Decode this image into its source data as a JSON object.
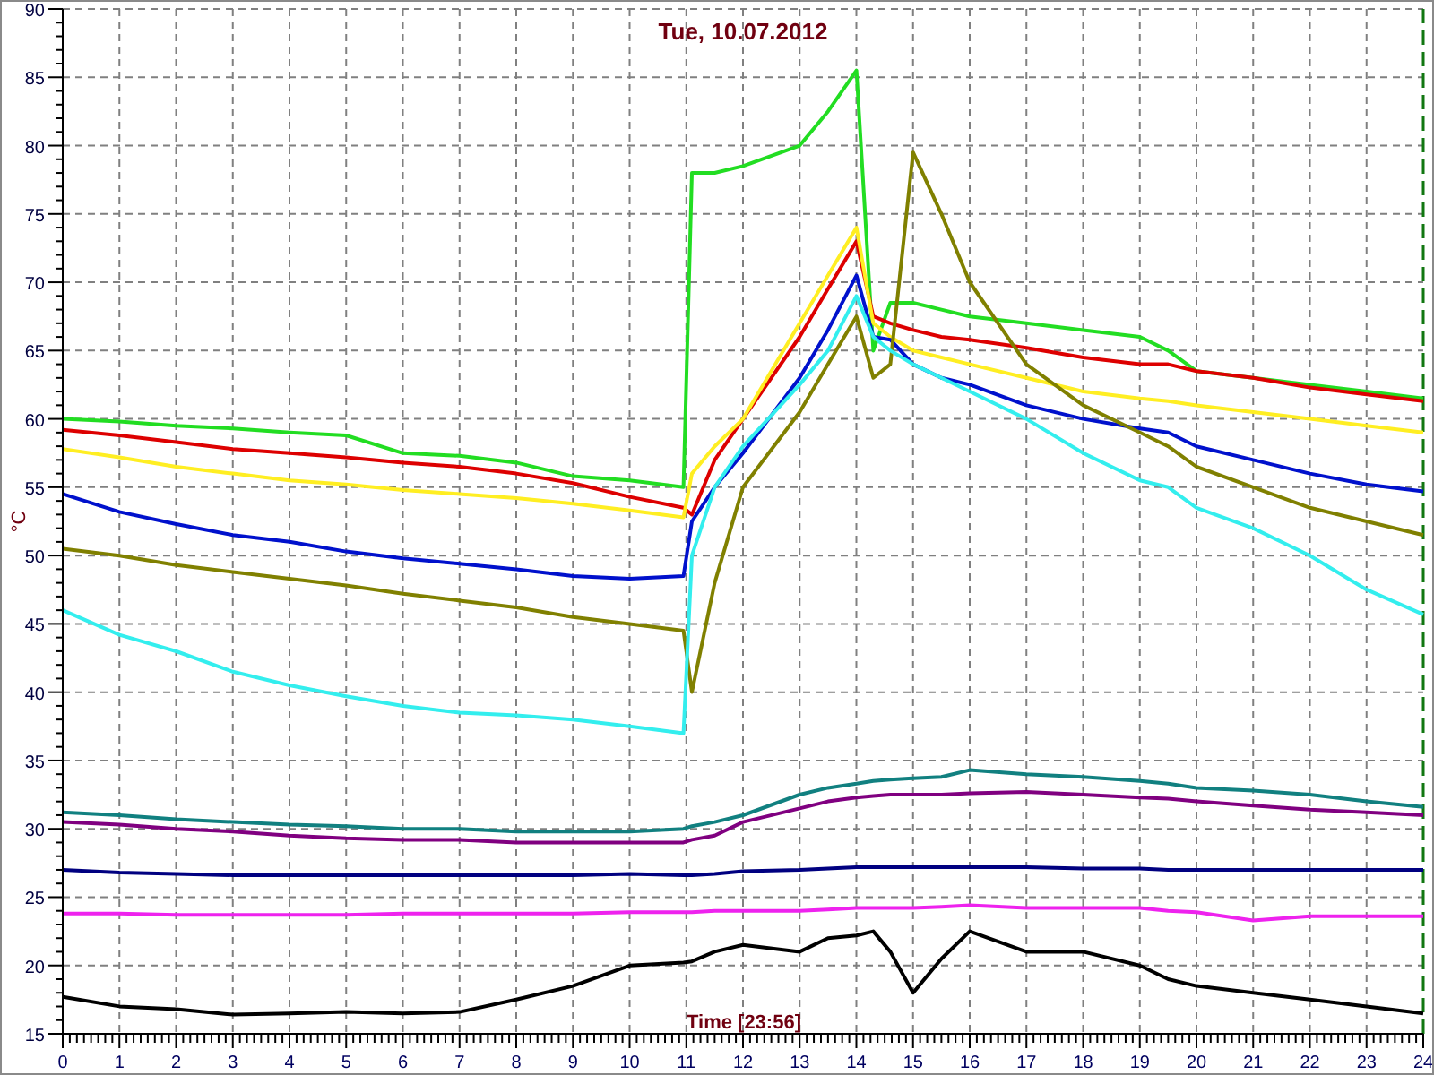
{
  "chart": {
    "chart_data": {
      "type": "line",
      "title": "Tue, 10.07.2012",
      "xlabel": "Time [23:56]",
      "ylabel": "°C",
      "grid": true,
      "xlim": [
        0,
        24
      ],
      "ylim": [
        15,
        90
      ],
      "xticks": [
        0,
        1,
        2,
        3,
        4,
        5,
        6,
        7,
        8,
        9,
        10,
        11,
        12,
        13,
        14,
        15,
        16,
        17,
        18,
        19,
        20,
        21,
        22,
        23,
        24
      ],
      "yticks": [
        15,
        20,
        25,
        30,
        35,
        40,
        45,
        50,
        55,
        60,
        65,
        70,
        75,
        80,
        85,
        90
      ],
      "x": [
        0,
        1,
        2,
        3,
        4,
        5,
        6,
        7,
        8,
        9,
        10,
        10.95,
        11.1,
        11.5,
        12,
        13,
        13.5,
        14,
        14.3,
        14.6,
        15,
        15.5,
        16,
        17,
        18,
        19,
        19.5,
        20,
        21,
        22,
        23,
        24
      ],
      "series": [
        {
          "color": "#22dd22",
          "values": [
            60,
            59.8,
            59.5,
            59.3,
            59,
            58.8,
            57.5,
            57.3,
            56.8,
            55.8,
            55.5,
            55,
            78,
            78,
            78.5,
            80,
            82.5,
            85.5,
            65,
            68.5,
            68.5,
            68,
            67.5,
            67,
            66.5,
            66,
            65,
            63.5,
            63,
            62.5,
            62,
            61.5
          ]
        },
        {
          "color": "#dd0000",
          "values": [
            59.2,
            58.8,
            58.3,
            57.8,
            57.5,
            57.2,
            56.8,
            56.5,
            56,
            55.3,
            54.3,
            53.5,
            53,
            57,
            60,
            66,
            69.5,
            73,
            67.5,
            67,
            66.5,
            66,
            65.8,
            65.2,
            64.5,
            64,
            64,
            63.5,
            63,
            62.3,
            61.8,
            61.3
          ]
        },
        {
          "color": "#ffee22",
          "values": [
            57.8,
            57.2,
            56.5,
            56,
            55.5,
            55.2,
            54.8,
            54.5,
            54.2,
            53.8,
            53.3,
            52.8,
            56,
            58,
            60,
            67,
            70.5,
            74,
            67,
            66,
            65,
            64.5,
            64,
            63,
            62,
            61.5,
            61.3,
            61,
            60.5,
            60,
            59.5,
            59
          ]
        },
        {
          "color": "#0011cc",
          "values": [
            54.5,
            53.2,
            52.3,
            51.5,
            51,
            50.3,
            49.8,
            49.4,
            49,
            48.5,
            48.3,
            48.5,
            52.5,
            55,
            57.5,
            63,
            66.5,
            70.5,
            66,
            65.8,
            64,
            63,
            62.5,
            61,
            60,
            59.3,
            59,
            58,
            57,
            56,
            55.2,
            54.7
          ]
        },
        {
          "color": "#808000",
          "values": [
            50.5,
            50,
            49.3,
            48.8,
            48.3,
            47.8,
            47.2,
            46.7,
            46.2,
            45.5,
            45,
            44.5,
            40,
            48,
            55,
            60.5,
            64,
            67.5,
            63,
            64,
            79.5,
            75,
            70,
            64,
            61,
            59,
            58,
            56.5,
            55,
            53.5,
            52.5,
            51.5
          ]
        },
        {
          "color": "#33eeee",
          "values": [
            46,
            44.2,
            43,
            41.5,
            40.5,
            39.7,
            39,
            38.5,
            38.3,
            38,
            37.5,
            37,
            50,
            55,
            58,
            62.5,
            65,
            69,
            66,
            65,
            64,
            63,
            62,
            60,
            57.5,
            55.5,
            55,
            53.5,
            52,
            50,
            47.5,
            45.7
          ]
        },
        {
          "color": "#118080",
          "values": [
            31.2,
            31,
            30.7,
            30.5,
            30.3,
            30.2,
            30,
            30,
            29.8,
            29.8,
            29.8,
            30,
            30.2,
            30.5,
            31,
            32.5,
            33,
            33.3,
            33.5,
            33.6,
            33.7,
            33.8,
            34.3,
            34,
            33.8,
            33.5,
            33.3,
            33,
            32.8,
            32.5,
            32,
            31.6
          ]
        },
        {
          "color": "#800080",
          "values": [
            30.5,
            30.3,
            30,
            29.8,
            29.5,
            29.3,
            29.2,
            29.2,
            29,
            29,
            29,
            29,
            29.2,
            29.5,
            30.5,
            31.5,
            32,
            32.3,
            32.4,
            32.5,
            32.5,
            32.5,
            32.6,
            32.7,
            32.5,
            32.3,
            32.2,
            32,
            31.7,
            31.4,
            31.2,
            31
          ]
        },
        {
          "color": "#000080",
          "values": [
            27,
            26.8,
            26.7,
            26.6,
            26.6,
            26.6,
            26.6,
            26.6,
            26.6,
            26.6,
            26.7,
            26.6,
            26.6,
            26.7,
            26.9,
            27,
            27.1,
            27.2,
            27.2,
            27.2,
            27.2,
            27.2,
            27.2,
            27.2,
            27.1,
            27.1,
            27,
            27,
            27,
            27,
            27,
            27
          ]
        },
        {
          "color": "#ee22ee",
          "values": [
            23.8,
            23.8,
            23.7,
            23.7,
            23.7,
            23.7,
            23.8,
            23.8,
            23.8,
            23.8,
            23.9,
            23.9,
            23.9,
            24,
            24,
            24,
            24.1,
            24.2,
            24.2,
            24.2,
            24.2,
            24.3,
            24.4,
            24.2,
            24.2,
            24.2,
            24,
            23.9,
            23.3,
            23.6,
            23.6,
            23.6
          ]
        },
        {
          "color": "#000000",
          "values": [
            17.7,
            17,
            16.8,
            16.4,
            16.5,
            16.6,
            16.5,
            16.6,
            17.5,
            18.5,
            20,
            20.2,
            20.3,
            21,
            21.5,
            21,
            22,
            22.2,
            22.5,
            21,
            18,
            20.5,
            22.5,
            21,
            21,
            20,
            19,
            18.5,
            18,
            17.5,
            17,
            16.5
          ]
        }
      ]
    }
  }
}
